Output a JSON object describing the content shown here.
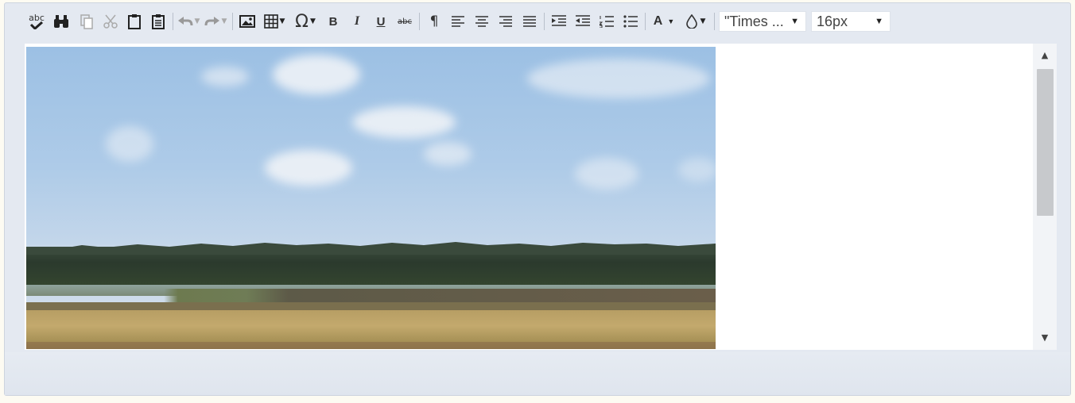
{
  "toolbar": {
    "spellcheck_text": "abc",
    "strike_text": "abc",
    "bold_label": "B",
    "italic_label": "I",
    "underline_label": "U",
    "font_color_label": "A",
    "symbol_label": "Ω",
    "font_family": {
      "value": "\"Times ..."
    },
    "font_size": {
      "value": "16px"
    }
  },
  "editor": {
    "content": {
      "image": {
        "icon": "landscape-photo"
      }
    }
  }
}
